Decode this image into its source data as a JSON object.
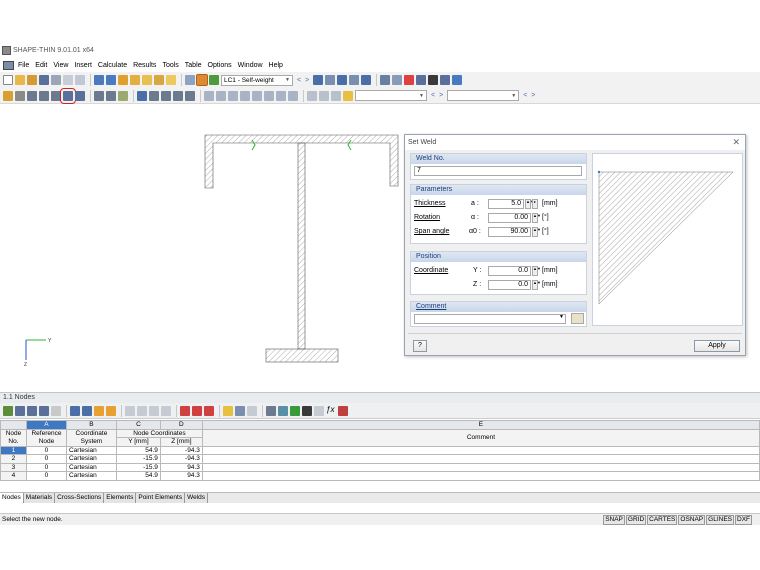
{
  "window": {
    "title": "SHAPE-THIN 9.01.01 x64"
  },
  "menu": [
    "File",
    "Edit",
    "View",
    "Insert",
    "Calculate",
    "Results",
    "Tools",
    "Table",
    "Options",
    "Window",
    "Help"
  ],
  "toolbar": {
    "loadcase": "LC1 - Self-weight",
    "combo2": "",
    "combo3": ""
  },
  "dialog": {
    "title": "Set Weld",
    "close_icon": "close-icon",
    "weld_no": {
      "heading": "Weld No.",
      "value": "7"
    },
    "parameters": {
      "heading": "Parameters",
      "thickness": {
        "label": "Thickness",
        "symbol": "a :",
        "value": "5.0",
        "unit": "[mm]"
      },
      "rotation": {
        "label": "Rotation",
        "symbol": "α :",
        "value": "0.00",
        "unit": "[°]"
      },
      "span_angle": {
        "label": "Span angle",
        "symbol": "α0 :",
        "value": "90.00",
        "unit": "[°]"
      }
    },
    "position": {
      "heading": "Position",
      "coordinate_label": "Coordinate",
      "y": {
        "symbol": "Y :",
        "value": "0.0",
        "unit": "[mm]"
      },
      "z": {
        "symbol": "Z :",
        "value": "0.0",
        "unit": "[mm]"
      }
    },
    "comment": {
      "heading": "Comment",
      "value": ""
    },
    "apply_label": "Apply"
  },
  "axes": {
    "y": "Y",
    "z": "Z"
  },
  "panel": {
    "title": "1.1 Nodes",
    "col_letters": [
      "A",
      "B",
      "C",
      "D",
      "E"
    ],
    "headers": {
      "node_no": "Node No.",
      "reference_node": "Reference Node",
      "coordinate_system": "Coordinate System",
      "node_coordinates": "Node Coordinates",
      "y": "Y [mm]",
      "z": "Z [mm]",
      "comment": "Comment"
    },
    "rows": [
      {
        "no": "1",
        "ref": "0",
        "sys": "Cartesian",
        "y": "54.9",
        "z": "-94.3",
        "comment": ""
      },
      {
        "no": "2",
        "ref": "0",
        "sys": "Cartesian",
        "y": "-15.9",
        "z": "-94.3",
        "comment": ""
      },
      {
        "no": "3",
        "ref": "0",
        "sys": "Cartesian",
        "y": "-15.9",
        "z": "94.3",
        "comment": ""
      },
      {
        "no": "4",
        "ref": "0",
        "sys": "Cartesian",
        "y": "54.9",
        "z": "94.3",
        "comment": ""
      }
    ],
    "tabs": [
      "Nodes",
      "Materials",
      "Cross-Sections",
      "Elements",
      "Point Elements",
      "Welds"
    ]
  },
  "status": {
    "message": "Select the new node.",
    "buttons": [
      "SNAP",
      "GRID",
      "CARTES",
      "OSNAP",
      "GLINES",
      "DXF"
    ]
  },
  "colors": {
    "accent": "#3d78c4",
    "weld_green": "#2db52d",
    "highlight_red": "#d62020"
  }
}
